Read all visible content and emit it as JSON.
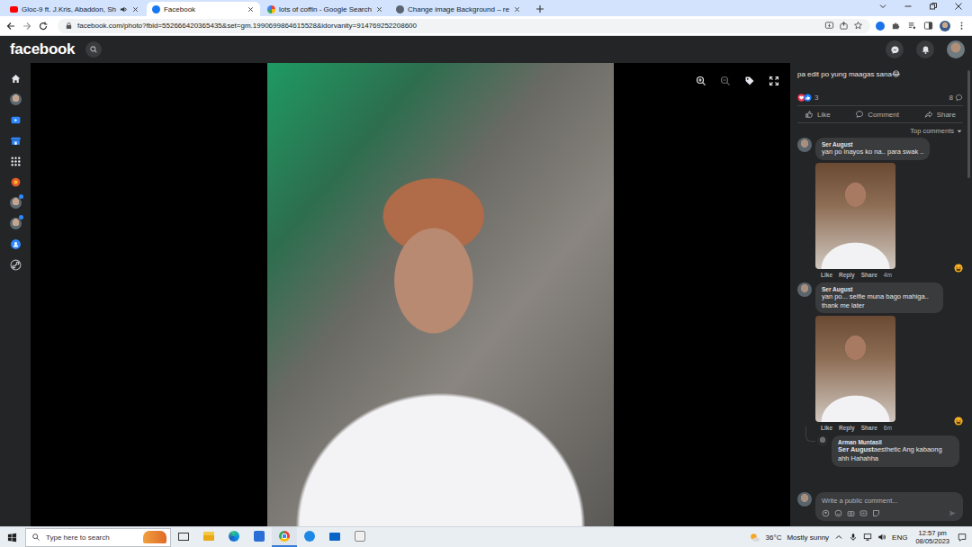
{
  "browser": {
    "tabs": [
      {
        "label": "Gloc-9 ft. J.Kris, Abaddon, Sh",
        "kind": "youtube",
        "audio": true,
        "selected": false
      },
      {
        "label": "Facebook",
        "kind": "facebook",
        "audio": false,
        "selected": true
      },
      {
        "label": "lots of coffin - Google Search",
        "kind": "google",
        "audio": false,
        "selected": false
      },
      {
        "label": "Change image Background – re",
        "kind": "remove",
        "audio": false,
        "selected": false
      }
    ],
    "url": "facebook.com/photo?fbid=552666420365435&set=gm.1990699864615528&idorvanity=914769252208600"
  },
  "facebook": {
    "logo": "facebook",
    "sidebar": [
      {
        "kind": "home",
        "badge": false
      },
      {
        "kind": "avatar",
        "badge": false
      },
      {
        "kind": "watch",
        "badge": false
      },
      {
        "kind": "marketplace",
        "badge": false
      },
      {
        "kind": "apps",
        "badge": false
      },
      {
        "kind": "game",
        "badge": false
      },
      {
        "kind": "avatar",
        "badge": true
      },
      {
        "kind": "avatar",
        "badge": true
      },
      {
        "kind": "groups",
        "badge": false
      },
      {
        "kind": "link",
        "badge": false
      }
    ]
  },
  "viewer": {
    "tools": [
      {
        "kind": "zoom-in",
        "disabled": false
      },
      {
        "kind": "zoom-out",
        "disabled": true
      },
      {
        "kind": "tag",
        "disabled": false
      },
      {
        "kind": "fullscreen",
        "disabled": false
      }
    ]
  },
  "post": {
    "caption": "pa edit po yung maagas sana😂",
    "reactions": "3",
    "comments": "8",
    "actions": [
      {
        "label": "Like",
        "kind": "like"
      },
      {
        "label": "Comment",
        "kind": "comment"
      },
      {
        "label": "Share",
        "kind": "share"
      }
    ],
    "sort": "Top comments"
  },
  "comments": [
    {
      "author": "Ser August",
      "text": "yan po inayos ko na.. para swak ..",
      "image": true,
      "actions": [
        "Like",
        "Reply",
        "Share"
      ],
      "time": "4m",
      "reacted": true,
      "reply": false
    },
    {
      "author": "Ser August",
      "text": "yan po... selfie muna bago mahiga.. thank me later",
      "image": true,
      "actions": [
        "Like",
        "Reply",
        "Share"
      ],
      "time": "6m",
      "reacted": true,
      "reply": false
    },
    {
      "author": "Arman Muntasil",
      "mention": "Ser August",
      "text": "aesthetic Ang kabaong ahh Hahahha",
      "image": false,
      "reacted": false,
      "reply": true
    }
  ],
  "composer": {
    "placeholder": "Write a public comment..."
  },
  "taskbar": {
    "search": "Type here to search",
    "apps": [
      {
        "kind": "taskview",
        "active": false
      },
      {
        "kind": "explorer",
        "active": false
      },
      {
        "kind": "edge",
        "active": false
      },
      {
        "kind": "store",
        "active": false
      },
      {
        "kind": "chrome",
        "active": true
      },
      {
        "kind": "vpn",
        "active": false
      },
      {
        "kind": "mail",
        "active": false
      },
      {
        "kind": "app",
        "active": false
      }
    ],
    "temperature": "36°C",
    "weather": "Mostly sunny",
    "language": "ENG",
    "time": "12:57 pm",
    "date": "08/05/2023"
  }
}
